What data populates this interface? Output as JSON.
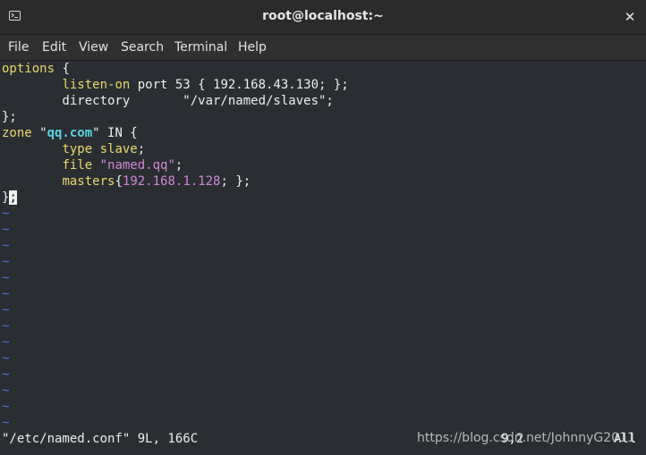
{
  "window": {
    "title": "root@localhost:~",
    "close_symbol": "✕"
  },
  "menu": [
    "File",
    "Edit",
    "View",
    "Search",
    "Terminal",
    "Help"
  ],
  "editor": {
    "lines": [
      {
        "segments": [
          {
            "text": "options",
            "cls": "kw"
          },
          {
            "text": " {",
            "cls": ""
          }
        ]
      },
      {
        "segments": [
          {
            "text": "        ",
            "cls": ""
          },
          {
            "text": "listen-on",
            "cls": "kw"
          },
          {
            "text": " port 53 { 192.168.43.130; };",
            "cls": ""
          }
        ]
      },
      {
        "segments": [
          {
            "text": "        directory       \"/var/named/slaves\";",
            "cls": ""
          }
        ]
      },
      {
        "segments": [
          {
            "text": "};",
            "cls": ""
          }
        ]
      },
      {
        "segments": [
          {
            "text": "zone",
            "cls": "kw"
          },
          {
            "text": " \"",
            "cls": ""
          },
          {
            "text": "qq.com",
            "cls": "hl"
          },
          {
            "text": "\" IN {",
            "cls": ""
          }
        ]
      },
      {
        "segments": [
          {
            "text": "        ",
            "cls": ""
          },
          {
            "text": "type",
            "cls": "kw"
          },
          {
            "text": " ",
            "cls": ""
          },
          {
            "text": "slave",
            "cls": "kw"
          },
          {
            "text": ";",
            "cls": ""
          }
        ]
      },
      {
        "segments": [
          {
            "text": "        ",
            "cls": ""
          },
          {
            "text": "file",
            "cls": "kw"
          },
          {
            "text": " ",
            "cls": ""
          },
          {
            "text": "\"named.qq\"",
            "cls": "str"
          },
          {
            "text": ";",
            "cls": ""
          }
        ]
      },
      {
        "segments": [
          {
            "text": "        ",
            "cls": ""
          },
          {
            "text": "masters",
            "cls": "kw"
          },
          {
            "text": "{",
            "cls": ""
          },
          {
            "text": "192.168.1.128",
            "cls": "num"
          },
          {
            "text": "; };",
            "cls": ""
          }
        ]
      },
      {
        "segments": [
          {
            "text": "}",
            "cls": ""
          },
          {
            "text": ";",
            "cls": "cursor"
          }
        ]
      }
    ],
    "tilde_char": "~",
    "tilde_count": 14
  },
  "status": {
    "file_info": "\"/etc/named.conf\" 9L, 166C",
    "position": "9,2",
    "scroll": "All"
  },
  "watermark": "https://blog.csdn.net/JohnnyG2011",
  "colors": {
    "keyword": "#e8d86a",
    "string": "#d287d6",
    "highlight": "#5ad4e6",
    "tilde": "#4a7bd6",
    "background": "#2a2e33"
  }
}
